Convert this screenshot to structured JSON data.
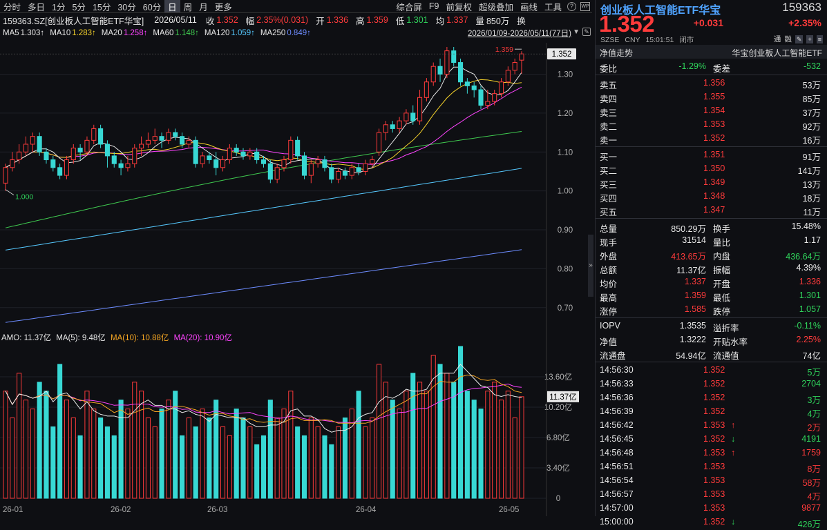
{
  "toolbar": {
    "left": [
      "分时",
      "多日",
      "1分",
      "5分",
      "15分",
      "30分",
      "60分",
      "日",
      "周",
      "月",
      "更多"
    ],
    "active": "日",
    "right": [
      "综合屏",
      "F9",
      "前复权",
      "超级叠加",
      "画线",
      "工具"
    ],
    "help_icon": "?",
    "wp_icon": "WP"
  },
  "header": {
    "code_name": "159363.SZ[创业板人工智能ETF华宝]",
    "date": "2026/05/11",
    "close_label": "收",
    "close": "1.352",
    "range_label": "幅",
    "range": "2.35%(0.031)",
    "open_label": "开",
    "open": "1.336",
    "high_label": "高",
    "high": "1.359",
    "low_label": "低",
    "low": "1.301",
    "avg_label": "均",
    "avg": "1.337",
    "vol_label": "量",
    "vol": "850万",
    "turn_label": "换"
  },
  "ma": [
    {
      "label": "MA5",
      "value": "1.303↑",
      "color": "#e8e8e8"
    },
    {
      "label": "MA10",
      "value": "1.283↑",
      "color": "#f5d22b"
    },
    {
      "label": "MA20",
      "value": "1.258↑",
      "color": "#ff44ff"
    },
    {
      "label": "MA60",
      "value": "1.148↑",
      "color": "#3fc94f"
    },
    {
      "label": "MA120",
      "value": "1.059↑",
      "color": "#56c9ff"
    },
    {
      "label": "MA250",
      "value": "0.849↑",
      "color": "#6d8cff"
    }
  ],
  "date_range": "2026/01/09-2026/05/11(77日)",
  "chart": {
    "current_price_label": "1.352",
    "high_mark": "1.359",
    "low_mark": "1.000",
    "y_ticks": [
      "1.30",
      "1.20",
      "1.10",
      "1.00",
      "0.90",
      "0.80",
      "0.70"
    ],
    "vol_ticks": [
      "13.60亿",
      "10.20亿",
      "6.80亿",
      "3.40亿",
      "0"
    ],
    "vol_current": "11.37亿",
    "x_ticks": [
      "26-01",
      "26-02",
      "26-03",
      "26-04",
      "26-05"
    ]
  },
  "amo": {
    "text": "AMO: 11.37亿",
    "ma5": "MA(5): 9.48亿",
    "ma10": "MA(10): 10.88亿",
    "ma20": "MA(20): 10.90亿",
    "ma5_color": "#e8e8e8",
    "ma10_color": "#f5a623",
    "ma20_color": "#ff44ff"
  },
  "chart_data": {
    "type": "candlestick",
    "ylim": [
      0.65,
      1.37
    ],
    "candles": [
      [
        1.02,
        1.06,
        1.0,
        1.07
      ],
      [
        1.06,
        1.08,
        1.05,
        1.1
      ],
      [
        1.08,
        1.1,
        1.07,
        1.12
      ],
      [
        1.1,
        1.12,
        1.09,
        1.14
      ],
      [
        1.12,
        1.14,
        1.1,
        1.15
      ],
      [
        1.14,
        1.1,
        1.09,
        1.15
      ],
      [
        1.1,
        1.08,
        1.07,
        1.11
      ],
      [
        1.08,
        1.06,
        1.05,
        1.09
      ],
      [
        1.06,
        1.04,
        1.03,
        1.07
      ],
      [
        1.04,
        1.08,
        1.03,
        1.09
      ],
      [
        1.08,
        1.11,
        1.07,
        1.12
      ],
      [
        1.11,
        1.1,
        1.08,
        1.12
      ],
      [
        1.1,
        1.13,
        1.09,
        1.14
      ],
      [
        1.13,
        1.16,
        1.12,
        1.17
      ],
      [
        1.16,
        1.12,
        1.11,
        1.17
      ],
      [
        1.12,
        1.09,
        1.06,
        1.13
      ],
      [
        1.09,
        1.07,
        1.06,
        1.1
      ],
      [
        1.07,
        1.06,
        1.04,
        1.08
      ],
      [
        1.06,
        1.07,
        1.05,
        1.09
      ],
      [
        1.07,
        1.11,
        1.06,
        1.12
      ],
      [
        1.11,
        1.12,
        1.09,
        1.14
      ],
      [
        1.12,
        1.13,
        1.11,
        1.15
      ],
      [
        1.13,
        1.14,
        1.12,
        1.16
      ],
      [
        1.14,
        1.13,
        1.11,
        1.15
      ],
      [
        1.13,
        1.15,
        1.12,
        1.16
      ],
      [
        1.15,
        1.14,
        1.13,
        1.16
      ],
      [
        1.14,
        1.12,
        1.11,
        1.15
      ],
      [
        1.12,
        1.13,
        1.11,
        1.14
      ],
      [
        1.13,
        1.07,
        1.06,
        1.14
      ],
      [
        1.07,
        1.09,
        1.06,
        1.1
      ],
      [
        1.09,
        1.08,
        1.07,
        1.1
      ],
      [
        1.08,
        1.06,
        1.04,
        1.1
      ],
      [
        1.06,
        1.08,
        1.05,
        1.09
      ],
      [
        1.08,
        1.11,
        1.07,
        1.12
      ],
      [
        1.11,
        1.1,
        1.09,
        1.12
      ],
      [
        1.1,
        1.09,
        1.08,
        1.11
      ],
      [
        1.09,
        1.1,
        1.08,
        1.11
      ],
      [
        1.1,
        1.08,
        1.07,
        1.11
      ],
      [
        1.08,
        1.07,
        1.06,
        1.09
      ],
      [
        1.07,
        1.03,
        1.02,
        1.08
      ],
      [
        1.03,
        1.06,
        1.02,
        1.07
      ],
      [
        1.06,
        1.08,
        1.05,
        1.09
      ],
      [
        1.08,
        1.13,
        1.07,
        1.14
      ],
      [
        1.13,
        1.09,
        1.08,
        1.14
      ],
      [
        1.09,
        1.04,
        1.03,
        1.1
      ],
      [
        1.04,
        1.07,
        1.02,
        1.08
      ],
      [
        1.07,
        1.08,
        1.06,
        1.09
      ],
      [
        1.08,
        1.06,
        1.05,
        1.09
      ],
      [
        1.06,
        1.03,
        1.02,
        1.07
      ],
      [
        1.03,
        1.05,
        1.02,
        1.06
      ],
      [
        1.05,
        1.04,
        1.03,
        1.06
      ],
      [
        1.04,
        1.06,
        1.03,
        1.07
      ],
      [
        1.06,
        1.05,
        1.04,
        1.07
      ],
      [
        1.05,
        1.07,
        1.04,
        1.08
      ],
      [
        1.07,
        1.08,
        1.06,
        1.09
      ],
      [
        1.1,
        1.15,
        1.09,
        1.16
      ],
      [
        1.15,
        1.17,
        1.13,
        1.18
      ],
      [
        1.17,
        1.16,
        1.15,
        1.18
      ],
      [
        1.16,
        1.18,
        1.15,
        1.19
      ],
      [
        1.18,
        1.2,
        1.17,
        1.21
      ],
      [
        1.2,
        1.18,
        1.17,
        1.22
      ],
      [
        1.18,
        1.24,
        1.17,
        1.26
      ],
      [
        1.24,
        1.28,
        1.23,
        1.29
      ],
      [
        1.28,
        1.32,
        1.27,
        1.33
      ],
      [
        1.32,
        1.3,
        1.28,
        1.34
      ],
      [
        1.3,
        1.36,
        1.29,
        1.37
      ],
      [
        1.36,
        1.33,
        1.32,
        1.37
      ],
      [
        1.33,
        1.28,
        1.27,
        1.34
      ],
      [
        1.28,
        1.27,
        1.25,
        1.29
      ],
      [
        1.27,
        1.26,
        1.24,
        1.28
      ],
      [
        1.26,
        1.22,
        1.21,
        1.27
      ],
      [
        1.22,
        1.23,
        1.21,
        1.26
      ],
      [
        1.23,
        1.25,
        1.22,
        1.26
      ],
      [
        1.25,
        1.28,
        1.24,
        1.29
      ],
      [
        1.28,
        1.31,
        1.27,
        1.32
      ],
      [
        1.31,
        1.33,
        1.3,
        1.34
      ],
      [
        1.336,
        1.352,
        1.301,
        1.359
      ]
    ],
    "volume": [
      12,
      9,
      14,
      11,
      10,
      13,
      12,
      8,
      15,
      11,
      9,
      7,
      12,
      10,
      9,
      8,
      7,
      11,
      10,
      13,
      12,
      9,
      8,
      10,
      11,
      12,
      7,
      9,
      8,
      10,
      9,
      11,
      8,
      7,
      10,
      9,
      8,
      6,
      7,
      11,
      9,
      10,
      12,
      8,
      7,
      9,
      8,
      7,
      6,
      8,
      9,
      10,
      12,
      8,
      9,
      15,
      13,
      11,
      10,
      12,
      14,
      13,
      12,
      16,
      15,
      14,
      13,
      17,
      12,
      11,
      10,
      12,
      13,
      11,
      12,
      9,
      11.37
    ],
    "series_colors": {
      "up": "#ff3b3b",
      "down": "#38d8d4"
    }
  },
  "right": {
    "title": "创业板人工智能ETF华宝",
    "code": "159363",
    "price": "1.352",
    "change": "+0.031",
    "change_pct": "+2.35%",
    "sub": [
      "SZSE",
      "CNY",
      "15:01:51",
      "闭市"
    ],
    "tags": [
      "通",
      "融"
    ],
    "nav_left": "净值走势",
    "nav_right": "华宝创业板人工智能ETF",
    "weibi_label": "委比",
    "weibi": "-1.29%",
    "weicha_label": "委差",
    "weicha": "-532",
    "asks": [
      {
        "label": "卖五",
        "price": "1.356",
        "vol": "53万"
      },
      {
        "label": "卖四",
        "price": "1.355",
        "vol": "85万"
      },
      {
        "label": "卖三",
        "price": "1.354",
        "vol": "37万"
      },
      {
        "label": "卖二",
        "price": "1.353",
        "vol": "92万"
      },
      {
        "label": "卖一",
        "price": "1.352",
        "vol": "16万"
      }
    ],
    "bids": [
      {
        "label": "买一",
        "price": "1.351",
        "vol": "91万"
      },
      {
        "label": "买二",
        "price": "1.350",
        "vol": "141万"
      },
      {
        "label": "买三",
        "price": "1.349",
        "vol": "13万"
      },
      {
        "label": "买四",
        "price": "1.348",
        "vol": "18万"
      },
      {
        "label": "买五",
        "price": "1.347",
        "vol": "11万"
      }
    ],
    "stats": [
      {
        "l1": "总量",
        "v1": "850.29万",
        "c1": "white",
        "l2": "换手",
        "v2": "15.48%",
        "c2": "white"
      },
      {
        "l1": "现手",
        "v1": "31514",
        "c1": "white",
        "l2": "量比",
        "v2": "1.17",
        "c2": "white"
      },
      {
        "l1": "外盘",
        "v1": "413.65万",
        "c1": "red",
        "l2": "内盘",
        "v2": "436.64万",
        "c2": "green"
      },
      {
        "l1": "总额",
        "v1": "11.37亿",
        "c1": "white",
        "l2": "振幅",
        "v2": "4.39%",
        "c2": "white"
      },
      {
        "l1": "均价",
        "v1": "1.337",
        "c1": "red",
        "l2": "开盘",
        "v2": "1.336",
        "c2": "red"
      },
      {
        "l1": "最高",
        "v1": "1.359",
        "c1": "red",
        "l2": "最低",
        "v2": "1.301",
        "c2": "green"
      },
      {
        "l1": "涨停",
        "v1": "1.585",
        "c1": "red",
        "l2": "跌停",
        "v2": "1.057",
        "c2": "green"
      }
    ],
    "stats2": [
      {
        "l1": "IOPV",
        "v1": "1.3535",
        "c1": "white",
        "l2": "溢折率",
        "v2": "-0.11%",
        "c2": "green"
      },
      {
        "l1": "净值",
        "v1": "1.3222",
        "c1": "white",
        "l2": "开贴水率",
        "v2": "2.25%",
        "c2": "red"
      },
      {
        "l1": "流通盘",
        "v1": "54.94亿",
        "c1": "white",
        "l2": "流通值",
        "v2": "74亿",
        "c2": "white"
      }
    ],
    "ticks": [
      {
        "t": "14:56:30",
        "p": "1.352",
        "a": "",
        "v": "5万",
        "vc": "green"
      },
      {
        "t": "14:56:33",
        "p": "1.352",
        "a": "",
        "v": "2704",
        "vc": "green"
      },
      {
        "t": "14:56:36",
        "p": "1.352",
        "a": "",
        "v": "3万",
        "vc": "green"
      },
      {
        "t": "14:56:39",
        "p": "1.352",
        "a": "",
        "v": "4万",
        "vc": "green"
      },
      {
        "t": "14:56:42",
        "p": "1.353",
        "a": "↑",
        "ac": "red",
        "v": "2万",
        "vc": "red"
      },
      {
        "t": "14:56:45",
        "p": "1.352",
        "a": "↓",
        "ac": "green",
        "v": "4191",
        "vc": "green"
      },
      {
        "t": "14:56:48",
        "p": "1.353",
        "a": "↑",
        "ac": "red",
        "v": "1759",
        "vc": "red"
      },
      {
        "t": "14:56:51",
        "p": "1.353",
        "a": "",
        "v": "8万",
        "vc": "red"
      },
      {
        "t": "14:56:54",
        "p": "1.353",
        "a": "",
        "v": "58万",
        "vc": "red"
      },
      {
        "t": "14:56:57",
        "p": "1.353",
        "a": "",
        "v": "4万",
        "vc": "red"
      },
      {
        "t": "14:57:00",
        "p": "1.353",
        "a": "",
        "v": "9877",
        "vc": "red"
      },
      {
        "t": "15:00:00",
        "p": "1.352",
        "a": "↓",
        "ac": "green",
        "v": "426万",
        "vc": "green"
      }
    ]
  }
}
